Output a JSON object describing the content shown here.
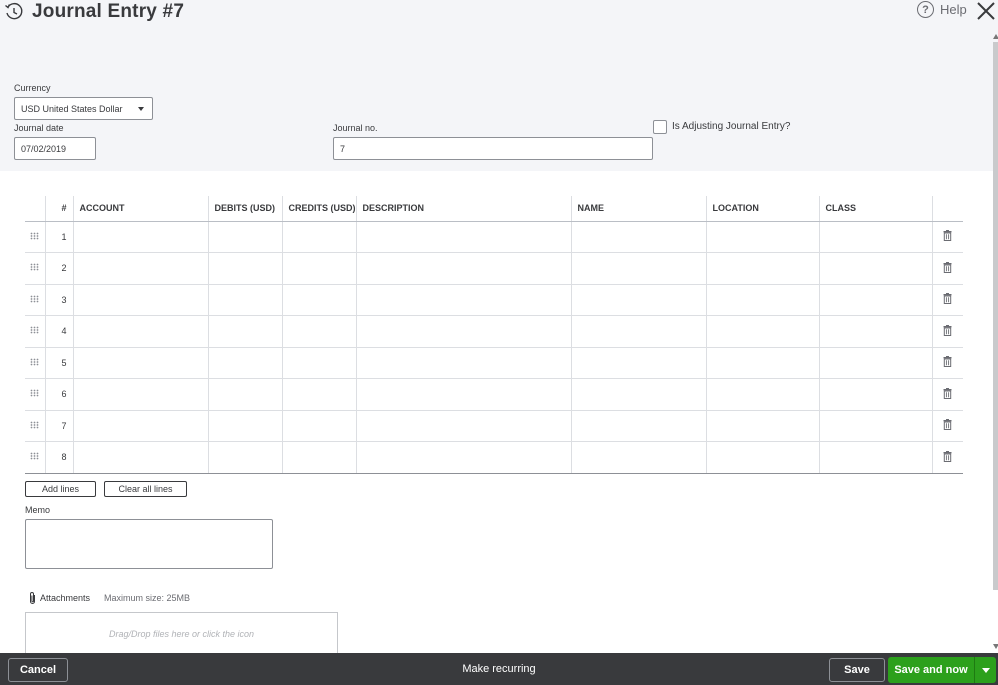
{
  "header": {
    "title": "Journal Entry #7",
    "help_label": "Help"
  },
  "form": {
    "currency_label": "Currency",
    "currency_value": "USD United States Dollar",
    "journal_date_label": "Journal date",
    "journal_date_value": "07/02/2019",
    "journal_no_label": "Journal no.",
    "journal_no_value": "7",
    "adjusting_label": "Is Adjusting Journal Entry?",
    "adjusting_checked": false
  },
  "grid": {
    "columns": [
      "#",
      "ACCOUNT",
      "DEBITS (USD)",
      "CREDITS (USD)",
      "DESCRIPTION",
      "NAME",
      "LOCATION",
      "CLASS"
    ],
    "rows": [
      "1",
      "2",
      "3",
      "4",
      "5",
      "6",
      "7",
      "8"
    ]
  },
  "actions": {
    "add_lines": "Add lines",
    "clear_all_lines": "Clear all lines"
  },
  "memo": {
    "label": "Memo",
    "value": ""
  },
  "attachments": {
    "label": "Attachments",
    "max_size": "Maximum size: 25MB",
    "dropzone_text": "Drag/Drop files here or click the icon"
  },
  "footer": {
    "cancel": "Cancel",
    "make_recurring": "Make recurring",
    "save": "Save",
    "save_and_new": "Save and now"
  },
  "colors": {
    "header_bg": "#f4f5f8",
    "footer_bg": "#393a3d",
    "primary_green": "#2ca01c",
    "text": "#393a3d"
  }
}
